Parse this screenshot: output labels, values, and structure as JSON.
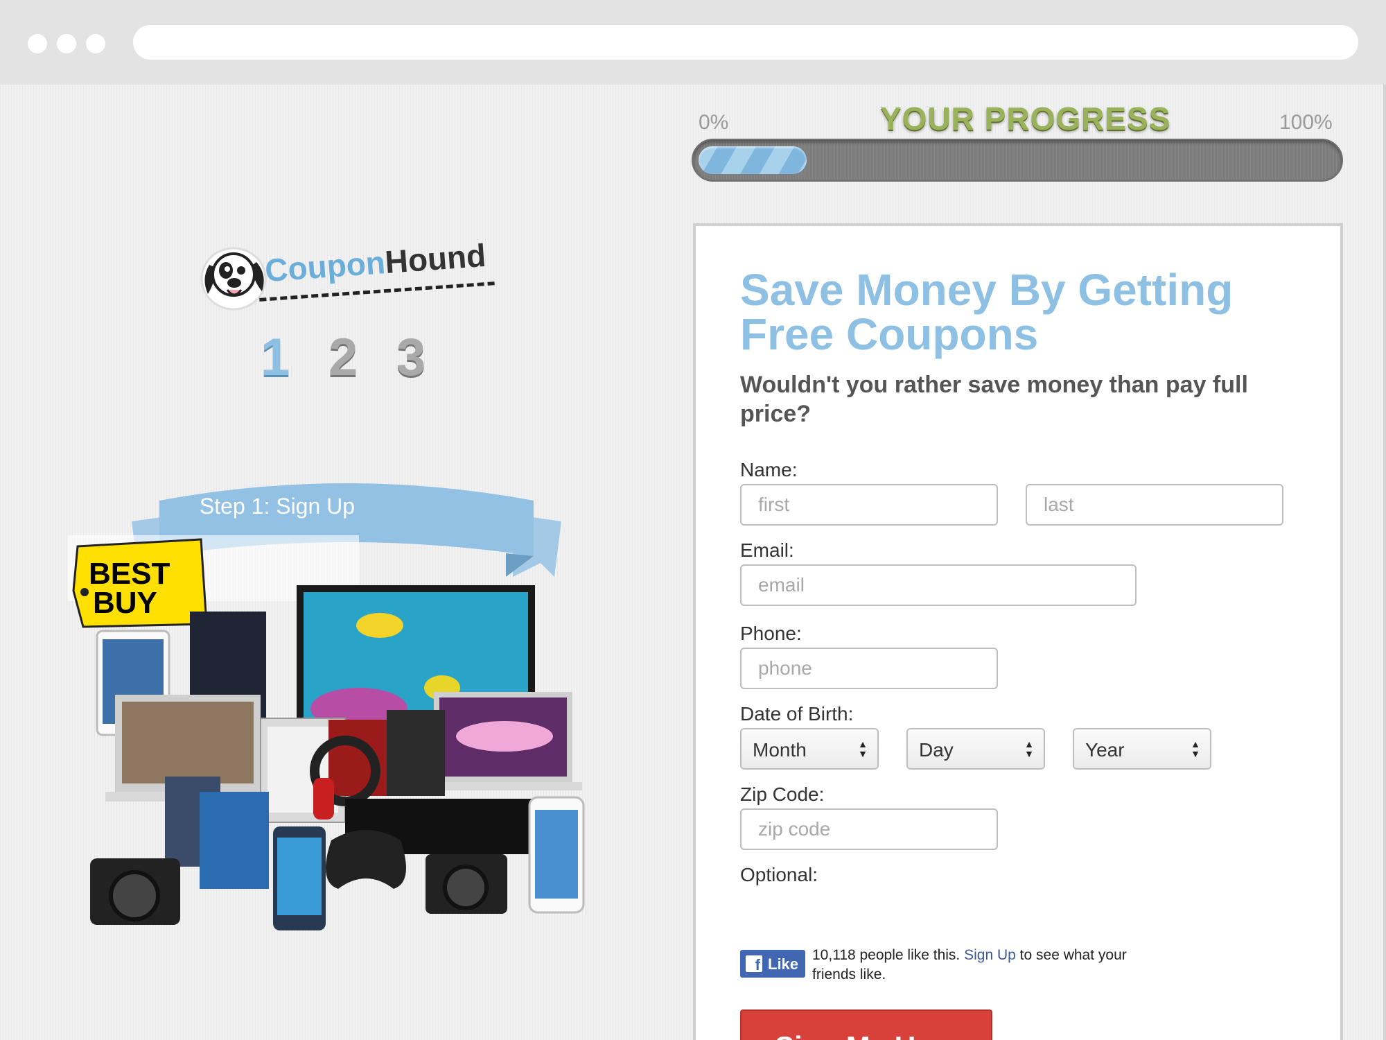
{
  "progress": {
    "min_label": "0%",
    "max_label": "100%",
    "title": "YOUR PROGRESS",
    "value_fraction": 0.17
  },
  "brand": {
    "logo_text_left": "Coupon",
    "logo_text_right": "Hound"
  },
  "steps": {
    "items": [
      "1",
      "2",
      "3"
    ],
    "active_index": 0,
    "active_color": "#8ec0e4",
    "inactive_color": "#a9a9a9",
    "ribbon_label": "Step 1: Sign Up"
  },
  "promo": {
    "retailer_logo": "BEST BUY"
  },
  "form": {
    "headline": "Save Money By Getting Free Coupons",
    "subheadline": "Wouldn't you rather save money than pay full price?",
    "name_label": "Name:",
    "first_placeholder": "first",
    "last_placeholder": "last",
    "email_label": "Email:",
    "email_placeholder": "email",
    "phone_label": "Phone:",
    "phone_placeholder": "phone",
    "dob_label": "Date of Birth:",
    "month_value": "Month",
    "day_value": "Day",
    "year_value": "Year",
    "zip_label": "Zip Code:",
    "zip_placeholder": "zip code",
    "optional_label": "Optional:",
    "submit_label": "Sign Me Up »"
  },
  "facebook": {
    "like_label": "Like",
    "count_text": "10,118 people like this.",
    "signup_link": "Sign Up",
    "suffix_text": "to see what your friends like."
  },
  "colors": {
    "accent_blue": "#8ec0e4",
    "progress_green": "#9ab25a",
    "submit_red": "#d8403a",
    "facebook_blue": "#4267b2"
  }
}
